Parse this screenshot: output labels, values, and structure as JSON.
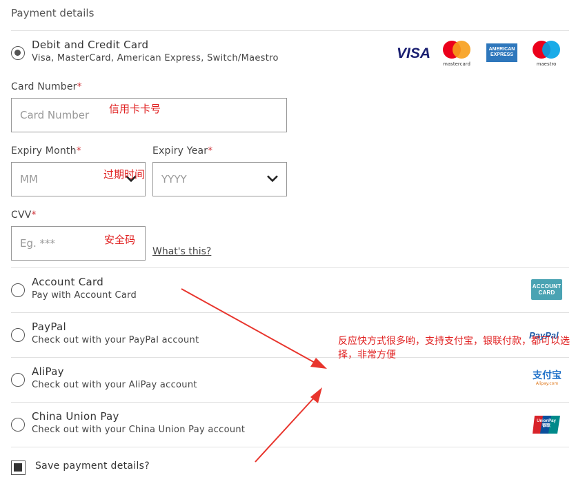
{
  "section_title": "Payment details",
  "card_option": {
    "title": "Debit and Credit Card",
    "subtitle": "Visa, MasterCard, American Express, Switch/Maestro",
    "brands": {
      "visa": "VISA",
      "mastercard": "mastercard",
      "amex_top": "AMERICAN",
      "amex_bottom": "EXPRESS",
      "maestro": "maestro"
    }
  },
  "fields": {
    "card_number_label": "Card Number",
    "card_number_placeholder": "Card Number",
    "expiry_month_label": "Expiry Month",
    "expiry_month_placeholder": "MM",
    "expiry_year_label": "Expiry Year",
    "expiry_year_placeholder": "YYYY",
    "cvv_label": "CVV",
    "cvv_placeholder": "Eg. ***",
    "required_mark": "*",
    "whats_this": "What's this?"
  },
  "annotations": {
    "card_number": "信用卡卡号",
    "expiry": "过期时间",
    "cvv": "安全码",
    "payment_note": "反应快方式很多哟，支持支付宝，银联付款，都可以选择，非常方便"
  },
  "options": [
    {
      "title": "Account Card",
      "subtitle": "Pay with Account Card",
      "logo": "ACCOUNT CARD"
    },
    {
      "title": "PayPal",
      "subtitle": "Check out with your PayPal account",
      "logo": "PayPal"
    },
    {
      "title": "AliPay",
      "subtitle": "Check out with your AliPay account",
      "logo": "支付宝",
      "logo_sub": "Alipay.com"
    },
    {
      "title": "China Union Pay",
      "subtitle": "Check out with your China Union Pay account",
      "logo": "UnionPay",
      "logo_sub": "银联"
    }
  ],
  "save_label": "Save payment details?",
  "colors": {
    "annotation": "#e02020",
    "required": "#d0343a",
    "visa": "#1a1f71",
    "mastercard_red": "#eb001b",
    "mastercard_orange": "#f79e1b",
    "amex": "#2e77bc",
    "maestro_blue": "#00a2e5",
    "account_card": "#4aa3b3"
  }
}
